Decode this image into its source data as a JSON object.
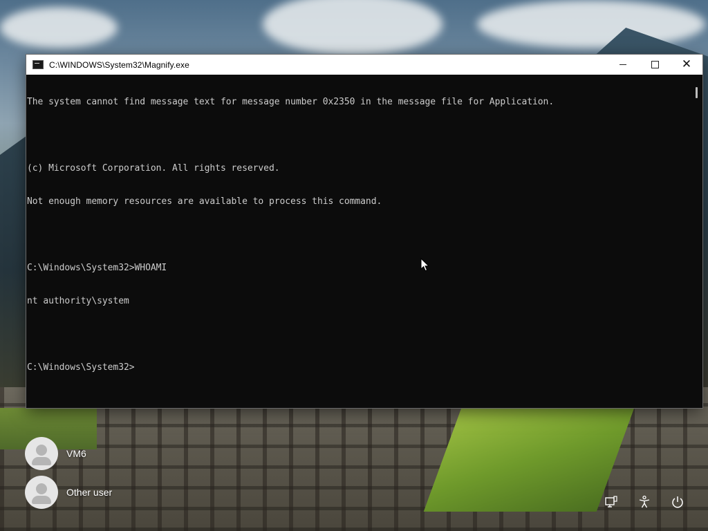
{
  "window": {
    "title": "C:\\WINDOWS\\System32\\Magnify.exe",
    "minimize_label": "Minimize",
    "maximize_label": "Maximize",
    "close_label": "Close"
  },
  "console": {
    "lines": [
      "The system cannot find message text for message number 0x2350 in the message file for Application.",
      "",
      "(c) Microsoft Corporation. All rights reserved.",
      "Not enough memory resources are available to process this command.",
      "",
      "C:\\Windows\\System32>WHOAMI",
      "nt authority\\system",
      "",
      "C:\\Windows\\System32>"
    ]
  },
  "lock_screen": {
    "users": [
      {
        "name": "VM6"
      },
      {
        "name": "Other user"
      }
    ],
    "tray_icons": [
      "network-icon",
      "accessibility-icon",
      "power-icon"
    ]
  },
  "colors": {
    "console_bg": "#0c0c0c",
    "console_text": "#cccccc",
    "titlebar_bg": "#ffffff"
  }
}
